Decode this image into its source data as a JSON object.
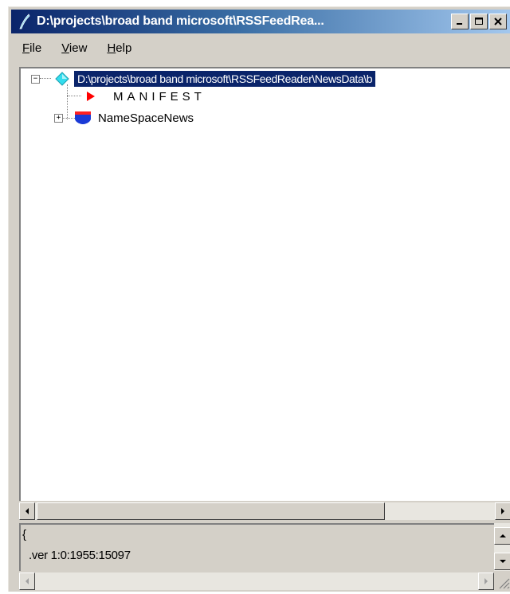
{
  "window": {
    "title": "D:\\projects\\broad band microsoft\\RSSFeedRea...",
    "buttons": {
      "minimize": "minimize",
      "maximize": "maximize",
      "close": "close"
    }
  },
  "menu": {
    "file": {
      "first": "F",
      "rest": "ile"
    },
    "view": {
      "first": "V",
      "rest": "iew"
    },
    "help": {
      "first": "H",
      "rest": "elp"
    }
  },
  "tree": {
    "root": {
      "label": "D:\\projects\\broad band microsoft\\RSSFeedReader\\NewsData\\b",
      "expander": "−",
      "icon": "diamond-icon"
    },
    "children": [
      {
        "label": "MANIFEST",
        "icon": "red-triangle-icon"
      },
      {
        "label": "NameSpaceNews",
        "icon": "shield-icon",
        "expander": "+"
      }
    ]
  },
  "text_pane": {
    "line1": "{",
    "line2": ".ver 1:0:1955:15097"
  },
  "colors": {
    "titlebar_start": "#0a246a",
    "titlebar_end": "#a6caf0",
    "selection": "#0a246a",
    "face": "#d4d0c8"
  }
}
